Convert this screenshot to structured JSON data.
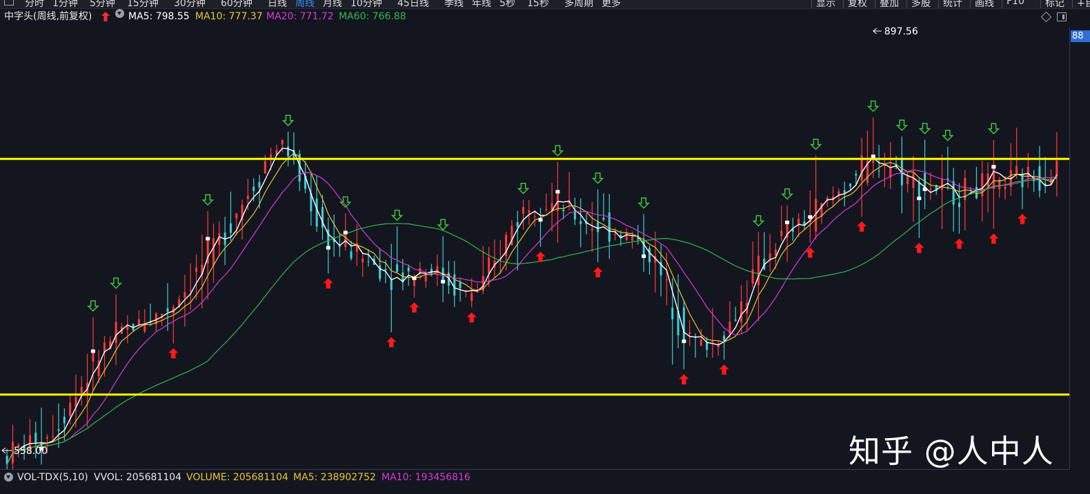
{
  "toolbar": {
    "periods": [
      "分时",
      "1分钟",
      "5分钟",
      "15分钟",
      "30分钟",
      "60分钟",
      "日线",
      "周线",
      "月线",
      "10分钟",
      "45日线",
      "季线",
      "年线",
      "5秒",
      "15秒",
      "多周期",
      "更多"
    ],
    "active_period": "周线",
    "right_items": [
      "显示",
      "复权",
      "叠加",
      "多股",
      "统计",
      "画线",
      "F10",
      "标记",
      "+自选"
    ]
  },
  "legend": {
    "title": "中字头(周线,前复权)",
    "ma5": "MA5: 798.55",
    "ma10": "MA10: 777.37",
    "ma20": "MA20: 771.72",
    "ma60": "MA60: 766.88"
  },
  "price_scale": {
    "top_label": "88"
  },
  "chart_data": {
    "type": "candlestick",
    "high_label": "897.56",
    "low_label": "558.00",
    "ylim": [
      550,
      920
    ],
    "resistance_level": 808,
    "support_level": 612,
    "colors": {
      "up": "#ff3b3b",
      "down": "#3fd0d8",
      "ma5": "#ffffff",
      "ma10": "#e8c53a",
      "ma20": "#d53bd8",
      "ma60": "#2fb84a",
      "levels": "#ffff00",
      "buy_arrow": "#ff1a1a",
      "sell_arrow": "#3fc43f"
    },
    "close_series": [
      562,
      565,
      568,
      570,
      573,
      577,
      575,
      579,
      584,
      590,
      598,
      606,
      612,
      620,
      628,
      636,
      644,
      651,
      656,
      660,
      664,
      667,
      670,
      672,
      676,
      675,
      678,
      680,
      684,
      688,
      694,
      700,
      707,
      714,
      720,
      726,
      733,
      741,
      750,
      758,
      765,
      772,
      780,
      787,
      797,
      806,
      812,
      818,
      820,
      814,
      804,
      792,
      782,
      770,
      758,
      748,
      742,
      738,
      736,
      735,
      733,
      730,
      726,
      722,
      720,
      718,
      716,
      714,
      712,
      712,
      713,
      715,
      717,
      718,
      716,
      713,
      710,
      706,
      702,
      698,
      696,
      697,
      700,
      705,
      712,
      720,
      730,
      742,
      752,
      760,
      766,
      770,
      772,
      773,
      772,
      770,
      768,
      766,
      763,
      760,
      757,
      755,
      754,
      753,
      752,
      750,
      748,
      746,
      744,
      742,
      738,
      734,
      728,
      720,
      710,
      698,
      688,
      676,
      666,
      660,
      656,
      654,
      654,
      656,
      660,
      664,
      670,
      678,
      688,
      698,
      708,
      716,
      724,
      732,
      738,
      742,
      746,
      750,
      754,
      757,
      760,
      764,
      768,
      772,
      776,
      781,
      786,
      790,
      795,
      798,
      800,
      803,
      806,
      806,
      804,
      800,
      796,
      792,
      790,
      788,
      786,
      784,
      783,
      782,
      781,
      780,
      780,
      781,
      782,
      783,
      784,
      785,
      786,
      787,
      788,
      789,
      790,
      792,
      793,
      794,
      795,
      796,
      798,
      799
    ],
    "sell_signal_count": 19,
    "buy_signal_count": 17
  },
  "volume_bar": {
    "indicator": "VOL-TDX(5,10)",
    "vvol": "VVOL: 205681104",
    "volume": "VOLUME: 205681104",
    "ma5": "MA5: 238902752",
    "ma10": "MA10: 193456816"
  },
  "watermark": "知乎 @人中人"
}
